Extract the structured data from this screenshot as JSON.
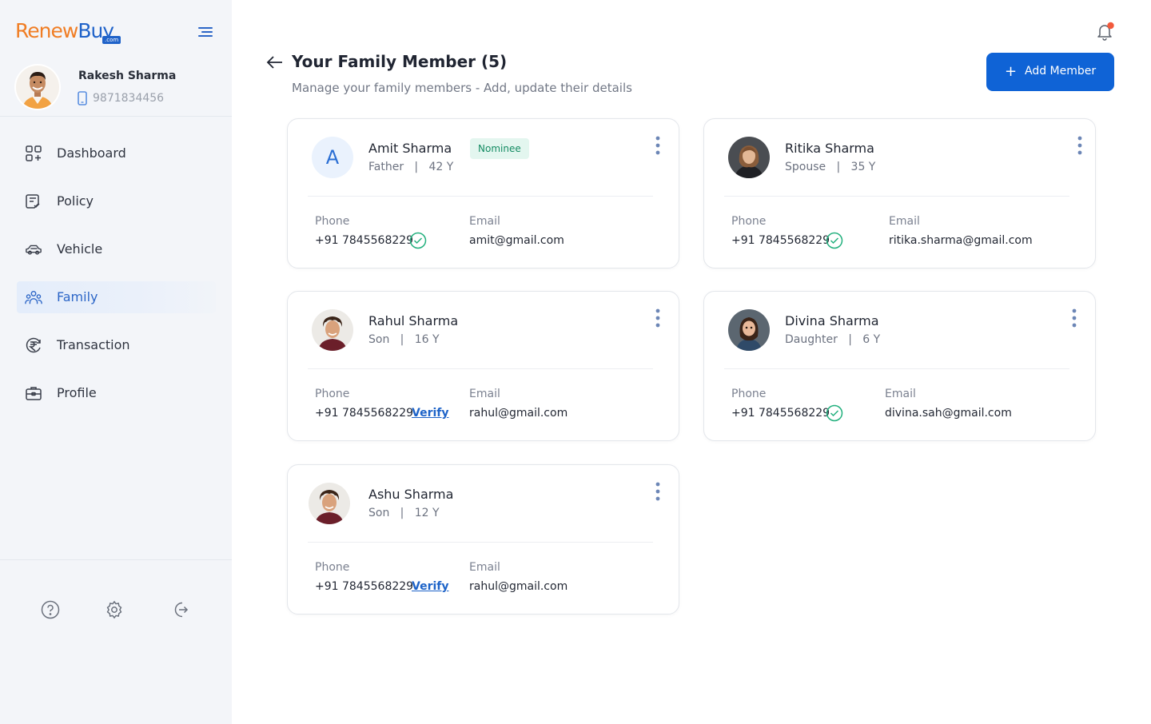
{
  "sidebar": {
    "logo": {
      "part1": "Renew",
      "part2": "Buy",
      "suffix": ".com"
    },
    "user": {
      "name": "Rakesh Sharma",
      "phone": "9871834456"
    },
    "items": [
      {
        "label": "Dashboard",
        "icon": "dashboard-icon",
        "active": false
      },
      {
        "label": "Policy",
        "icon": "policy-icon",
        "active": false
      },
      {
        "label": "Vehicle",
        "icon": "car-icon",
        "active": false
      },
      {
        "label": "Family",
        "icon": "family-icon",
        "active": true
      },
      {
        "label": "Transaction",
        "icon": "rupee-icon",
        "active": false
      },
      {
        "label": "Profile",
        "icon": "briefcase-icon",
        "active": false
      }
    ],
    "footer_icons": [
      "help-icon",
      "settings-icon",
      "logout-icon"
    ]
  },
  "header": {
    "title": "Your Family Member (5)",
    "subtitle": "Manage your family members - Add, update their details",
    "add_button": "Add Member"
  },
  "labels": {
    "phone": "Phone",
    "email": "Email",
    "verify": "Verify",
    "nominee": "Nominee"
  },
  "members": [
    {
      "name": "Amit Sharma",
      "relation": "Father",
      "age": "42 Y",
      "initial": "A",
      "nominee": true,
      "phone": "+91 7845568229",
      "verified": true,
      "email": "amit@gmail.com"
    },
    {
      "name": "Ritika Sharma",
      "relation": "Spouse",
      "age": "35 Y",
      "nominee": false,
      "phone": "+91 7845568229",
      "verified": true,
      "email": "ritika.sharma@gmail.com"
    },
    {
      "name": "Rahul Sharma",
      "relation": "Son",
      "age": "16 Y",
      "nominee": false,
      "phone": "+91 7845568229",
      "verified": false,
      "email": "rahul@gmail.com"
    },
    {
      "name": "Divina Sharma",
      "relation": "Daughter",
      "age": "6 Y",
      "nominee": false,
      "phone": "+91 7845568229",
      "verified": true,
      "email": "divina.sah@gmail.com"
    },
    {
      "name": "Ashu Sharma",
      "relation": "Son",
      "age": "12 Y",
      "nominee": false,
      "phone": "+91 7845568229",
      "verified": false,
      "email": "rahul@gmail.com"
    }
  ],
  "colors": {
    "primary": "#0f63d6",
    "accent_orange": "#f07d24",
    "success": "#22b07d",
    "notification_dot": "#f25a3c"
  }
}
